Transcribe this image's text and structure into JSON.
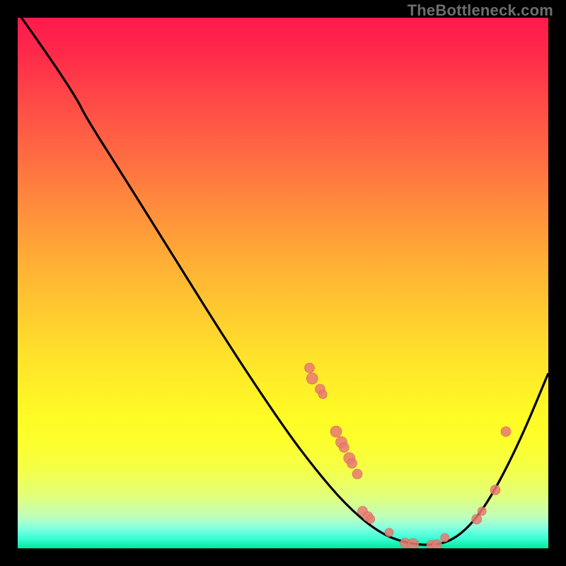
{
  "watermark": "TheBottleneck.com",
  "colors": {
    "curve": "#000000",
    "marker_fill": "#e77a72",
    "marker_edge": "#d16058",
    "background": "#000000"
  },
  "chart_data": {
    "type": "line",
    "title": "",
    "xlabel": "",
    "ylabel": "",
    "xlim": [
      0,
      100
    ],
    "ylim": [
      0,
      100
    ],
    "grid": false,
    "curve": [
      {
        "x": 0,
        "y": 101
      },
      {
        "x": 5,
        "y": 94
      },
      {
        "x": 11,
        "y": 85
      },
      {
        "x": 13,
        "y": 81
      },
      {
        "x": 20,
        "y": 70
      },
      {
        "x": 30,
        "y": 54
      },
      {
        "x": 40,
        "y": 38
      },
      {
        "x": 50,
        "y": 23
      },
      {
        "x": 56,
        "y": 15
      },
      {
        "x": 62,
        "y": 8
      },
      {
        "x": 68,
        "y": 3
      },
      {
        "x": 73,
        "y": 1
      },
      {
        "x": 78,
        "y": 0.5
      },
      {
        "x": 82,
        "y": 1.5
      },
      {
        "x": 86,
        "y": 5
      },
      {
        "x": 90,
        "y": 11
      },
      {
        "x": 95,
        "y": 21
      },
      {
        "x": 100,
        "y": 33
      }
    ],
    "markers": [
      {
        "x": 55,
        "y": 34,
        "r": 7
      },
      {
        "x": 55.5,
        "y": 32,
        "r": 8
      },
      {
        "x": 57,
        "y": 30,
        "r": 7
      },
      {
        "x": 57.5,
        "y": 29,
        "r": 6
      },
      {
        "x": 60,
        "y": 22,
        "r": 8
      },
      {
        "x": 61,
        "y": 20,
        "r": 8
      },
      {
        "x": 61.5,
        "y": 19,
        "r": 7
      },
      {
        "x": 62.5,
        "y": 17,
        "r": 8
      },
      {
        "x": 63,
        "y": 16,
        "r": 7
      },
      {
        "x": 64,
        "y": 14,
        "r": 7
      },
      {
        "x": 65,
        "y": 7,
        "r": 7
      },
      {
        "x": 66,
        "y": 6,
        "r": 7
      },
      {
        "x": 66.5,
        "y": 5.5,
        "r": 6
      },
      {
        "x": 70,
        "y": 3,
        "r": 6
      },
      {
        "x": 73,
        "y": 1,
        "r": 7
      },
      {
        "x": 74.5,
        "y": 0.8,
        "r": 8
      },
      {
        "x": 78,
        "y": 0.6,
        "r": 7
      },
      {
        "x": 79,
        "y": 0.7,
        "r": 7
      },
      {
        "x": 80.5,
        "y": 2,
        "r": 6
      },
      {
        "x": 86.5,
        "y": 5.5,
        "r": 7
      },
      {
        "x": 87.5,
        "y": 7,
        "r": 6
      },
      {
        "x": 90,
        "y": 11,
        "r": 7
      },
      {
        "x": 92,
        "y": 22,
        "r": 7
      }
    ],
    "gradient_bands": [
      {
        "pos": 0.0,
        "color": "#ff1a4d"
      },
      {
        "pos": 0.5,
        "color": "#ffc22e"
      },
      {
        "pos": 0.8,
        "color": "#fdff2d"
      },
      {
        "pos": 0.96,
        "color": "#6fffcd"
      },
      {
        "pos": 1.0,
        "color": "#00e89e"
      }
    ]
  }
}
